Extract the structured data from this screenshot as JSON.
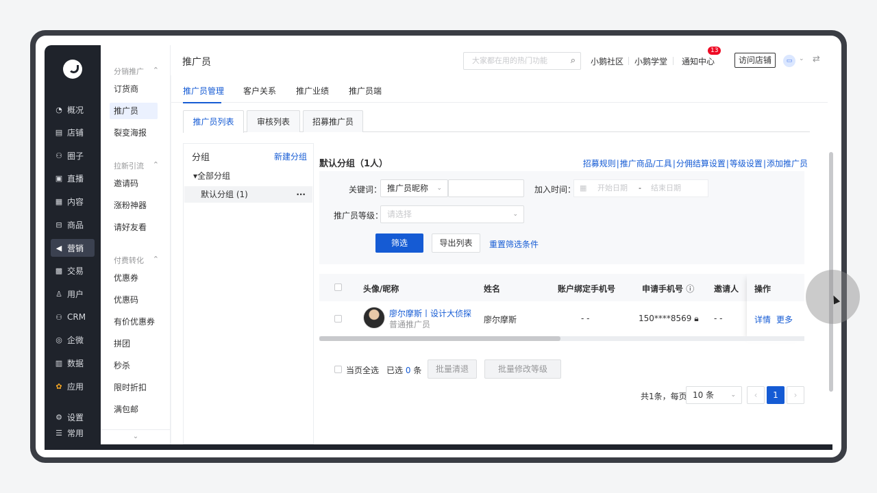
{
  "nav_primary": [
    {
      "label": "概况",
      "icon": "gauge-icon",
      "glyph": "◔"
    },
    {
      "label": "店铺",
      "icon": "store-icon",
      "glyph": "▤"
    },
    {
      "label": "圈子",
      "icon": "group-icon",
      "glyph": "⚇"
    },
    {
      "label": "直播",
      "icon": "live-icon",
      "glyph": "▣"
    },
    {
      "label": "内容",
      "icon": "document-icon",
      "glyph": "▦"
    },
    {
      "label": "商品",
      "icon": "bag-icon",
      "glyph": "⊟"
    },
    {
      "label": "营销",
      "icon": "megaphone-icon",
      "glyph": "◀"
    },
    {
      "label": "交易",
      "icon": "exchange-icon",
      "glyph": "▩"
    },
    {
      "label": "用户",
      "icon": "user-icon",
      "glyph": "♙"
    },
    {
      "label": "CRM",
      "icon": "crm-icon",
      "glyph": "⚇"
    },
    {
      "label": "企微",
      "icon": "wecom-icon",
      "glyph": "◎"
    },
    {
      "label": "数据",
      "icon": "chart-icon",
      "glyph": "▥"
    },
    {
      "label": "应用",
      "icon": "apps-icon",
      "glyph": "✿"
    },
    {
      "label": "设置",
      "icon": "gear-icon",
      "glyph": "⚙"
    },
    {
      "label": "常用",
      "icon": "list-icon",
      "glyph": "☰"
    }
  ],
  "nav_secondary": {
    "groups": [
      "分销推广",
      "拉新引流",
      "付费转化"
    ],
    "items": [
      "订货商",
      "推广员",
      "裂变海报",
      "邀请码",
      "涨粉神器",
      "请好友看",
      "优惠券",
      "优惠码",
      "有价优惠券",
      "拼团",
      "秒杀",
      "限时折扣",
      "满包邮"
    ],
    "collapse_glyph": "⌄"
  },
  "header": {
    "title": "推广员",
    "search_placeholder": "大家都在用的热门功能",
    "links": [
      "小鹅社区",
      "小鹅学堂",
      "通知中心"
    ],
    "notification_count": "13",
    "visit_store": "访问店铺"
  },
  "top_tabs": [
    "推广员管理",
    "客户关系",
    "推广业绩",
    "推广员端"
  ],
  "sub_tabs": [
    "推广员列表",
    "审核列表",
    "招募推广员"
  ],
  "group_panel": {
    "title": "分组",
    "new_group": "新建分组",
    "all_groups": "全部分组",
    "default_group": "默认分组 (1)",
    "more_glyph": "···"
  },
  "content": {
    "title": "默认分组（1人）",
    "links": [
      "招募规则",
      "推广商品/工具",
      "分佣结算设置",
      "等级设置",
      "添加推广员"
    ]
  },
  "filter": {
    "keyword_label": "关键词：",
    "keyword_type": "推广员昵称",
    "keyword_value": "",
    "join_time_label": "加入时间：",
    "start_date_placeholder": "开始日期",
    "end_date_placeholder": "结束日期",
    "date_separator": "-",
    "level_label": "推广员等级：",
    "level_placeholder": "请选择",
    "filter_button": "筛选",
    "export_button": "导出列表",
    "reset_link": "重置筛选条件"
  },
  "table": {
    "headers": [
      "头像/昵称",
      "姓名",
      "账户绑定手机号",
      "申请手机号",
      "邀请人",
      "操作"
    ],
    "rows": [
      {
        "nickname": "廖尔摩斯丨设计大侦探",
        "level": "普通推广员",
        "name": "廖尔摩斯",
        "bound_phone": "- -",
        "apply_phone": "150****8569",
        "inviter": "- -",
        "actions": [
          "详情",
          "更多"
        ]
      }
    ]
  },
  "bulk": {
    "select_page": "当页全选",
    "selected_prefix": "已选",
    "selected_count": "0",
    "selected_suffix": "条",
    "batch_remove": "批量清退",
    "batch_level": "批量修改等级"
  },
  "pagination": {
    "summary": "共1条，每页",
    "page_size": "10 条",
    "prev_glyph": "‹",
    "current_page": "1",
    "next_glyph": "›"
  },
  "colors": {
    "primary": "#155bd4",
    "sidebar": "#1f232b",
    "badge": "#ee0a24"
  }
}
